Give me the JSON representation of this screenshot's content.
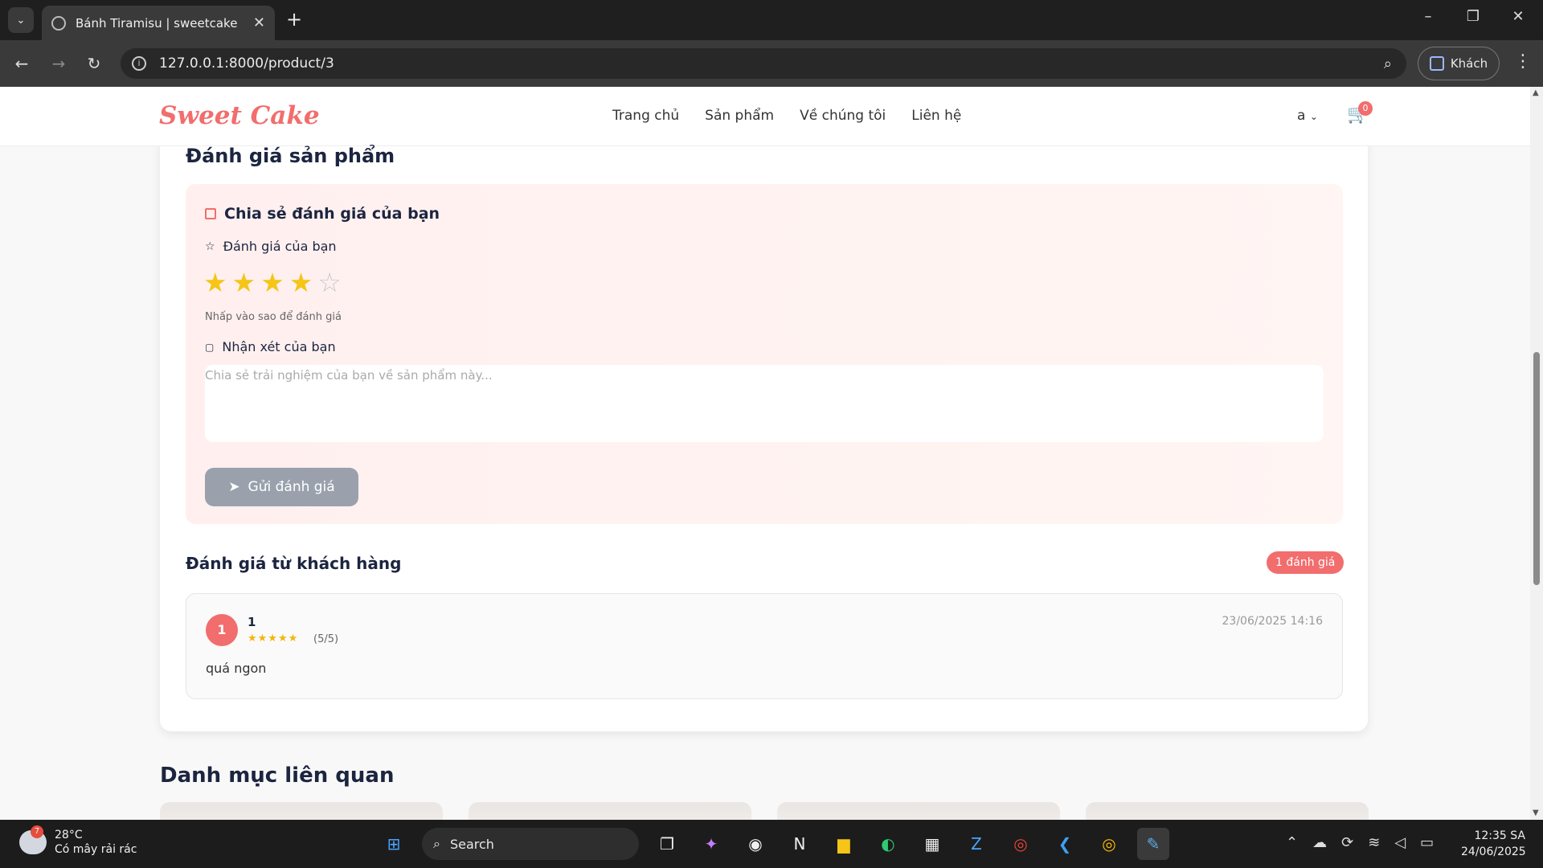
{
  "browser": {
    "tab_title": "Bánh Tiramisu | sweetcake",
    "url": "127.0.0.1:8000/product/3",
    "profile_label": "Khách"
  },
  "site": {
    "logo": "Sweet Cake",
    "nav": [
      "Trang chủ",
      "Sản phẩm",
      "Về chúng tôi",
      "Liên hệ"
    ],
    "user": "a",
    "cart_count": "0"
  },
  "review_section": {
    "title": "Đánh giá sản phẩm",
    "form_title": "Chia sẻ đánh giá của bạn",
    "rating_label": "Đánh giá của bạn",
    "rating_value": 4,
    "rating_max": 5,
    "rating_hint": "Nhấp vào sao để đánh giá",
    "comment_label": "Nhận xét của bạn",
    "comment_placeholder": "Chia sẻ trải nghiệm của bạn về sản phẩm này...",
    "submit_label": "Gửi đánh giá"
  },
  "customer_reviews": {
    "title": "Đánh giá từ khách hàng",
    "count_label": "1 đánh giá",
    "items": [
      {
        "avatar": "1",
        "name": "1",
        "stars": "★★★★★",
        "score": "(5/5)",
        "date": "23/06/2025 14:16",
        "text": "quá ngon"
      }
    ]
  },
  "related": {
    "title": "Danh mục liên quan"
  },
  "taskbar": {
    "weather_temp": "28°C",
    "weather_desc": "Có mây rải rác",
    "weather_badge": "7",
    "search_label": "Search",
    "time": "12:35 SA",
    "date": "24/06/2025"
  },
  "colors": {
    "accent": "#f26d6d",
    "star": "#f5c518",
    "submit_disabled": "#9aa1ad"
  }
}
